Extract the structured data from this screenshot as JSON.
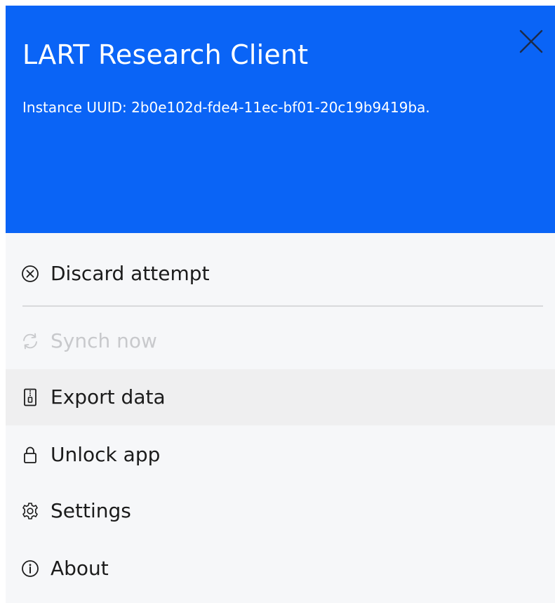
{
  "header": {
    "title": "LART Research Client",
    "uuid_text": "Instance UUID: 2b0e102d-fde4-11ec-bf01-20c19b9419ba.",
    "close_icon": "close-icon",
    "background_color": "#0a64f6"
  },
  "menu": {
    "items": [
      {
        "label": "Discard attempt",
        "icon": "circle-x-icon",
        "disabled": false
      },
      {
        "label": "Synch now",
        "icon": "sync-icon",
        "disabled": true
      },
      {
        "label": "Export data",
        "icon": "zip-archive-icon",
        "disabled": false,
        "hovered": true
      },
      {
        "label": "Unlock app",
        "icon": "lock-icon",
        "disabled": false
      },
      {
        "label": "Settings",
        "icon": "gear-icon",
        "disabled": false
      },
      {
        "label": "About",
        "icon": "info-icon",
        "disabled": false
      }
    ]
  }
}
